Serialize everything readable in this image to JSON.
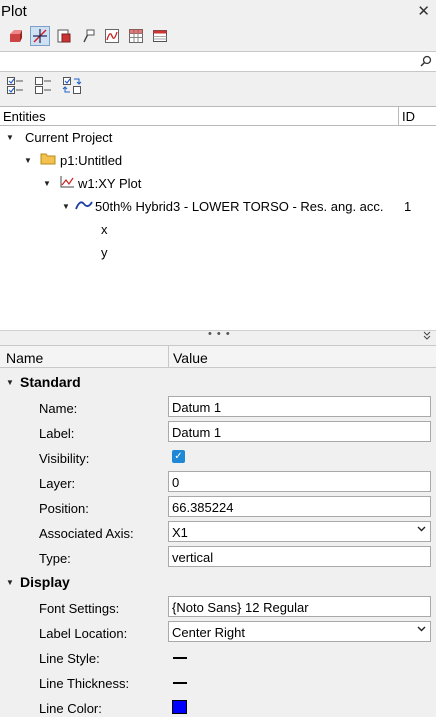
{
  "panel": {
    "title": "Plot"
  },
  "search": {
    "value": "",
    "placeholder": ""
  },
  "tree": {
    "col_entities": "Entities",
    "col_id": "ID",
    "nodes": [
      {
        "label": "Current Project",
        "id": ""
      },
      {
        "label": "p1:Untitled",
        "id": ""
      },
      {
        "label": "w1:XY Plot",
        "id": ""
      },
      {
        "label": "50th% Hybrid3   - LOWER TORSO - Res. ang. acc.",
        "id": "1"
      },
      {
        "label": "x",
        "id": ""
      },
      {
        "label": "y",
        "id": ""
      }
    ]
  },
  "splitter": {
    "dots": "• • •"
  },
  "props": {
    "col_name": "Name",
    "col_value": "Value",
    "sections": [
      {
        "title": "Standard",
        "rows": [
          {
            "label": "Name:",
            "value": "Datum 1",
            "kind": "text"
          },
          {
            "label": "Label:",
            "value": "Datum 1",
            "kind": "text"
          },
          {
            "label": "Visibility:",
            "value": "true",
            "kind": "checkbox"
          },
          {
            "label": "Layer:",
            "value": "0",
            "kind": "text"
          },
          {
            "label": "Position:",
            "value": "66.385224",
            "kind": "text"
          },
          {
            "label": "Associated Axis:",
            "value": "X1",
            "kind": "select"
          },
          {
            "label": "Type:",
            "value": "vertical",
            "kind": "text"
          }
        ]
      },
      {
        "title": "Display",
        "rows": [
          {
            "label": "Font Settings:",
            "value": "{Noto Sans} 12 Regular",
            "kind": "text"
          },
          {
            "label": "Label Location:",
            "value": "Center Right",
            "kind": "select"
          },
          {
            "label": "Line Style:",
            "value": "solid",
            "kind": "line"
          },
          {
            "label": "Line Thickness:",
            "value": "thin",
            "kind": "line"
          },
          {
            "label": "Line Color:",
            "value": "#0000ff",
            "kind": "color"
          }
        ]
      }
    ]
  },
  "colors": {
    "accent": "#1e88d6",
    "line_color": "#0000ff",
    "curve": "#1a3fa8",
    "folder": "#f2c14e"
  }
}
